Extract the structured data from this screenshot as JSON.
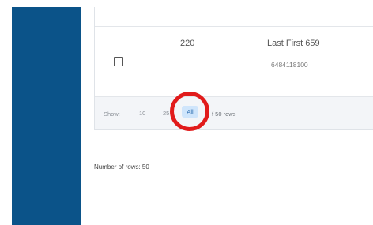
{
  "table": {
    "row": {
      "id": "220",
      "name": "Last First 659",
      "phone": "6484118100"
    }
  },
  "pager": {
    "show_label": "Show:",
    "options": [
      "10",
      "25",
      "All"
    ],
    "selected": "All",
    "rows_info": "f 50 rows"
  },
  "footer": {
    "rows_count": "Number of rows: 50"
  },
  "colors": {
    "sidebar": "#0b5389",
    "selected_option_bg": "#cfe5fb",
    "highlight_ring": "#e11b1b"
  }
}
